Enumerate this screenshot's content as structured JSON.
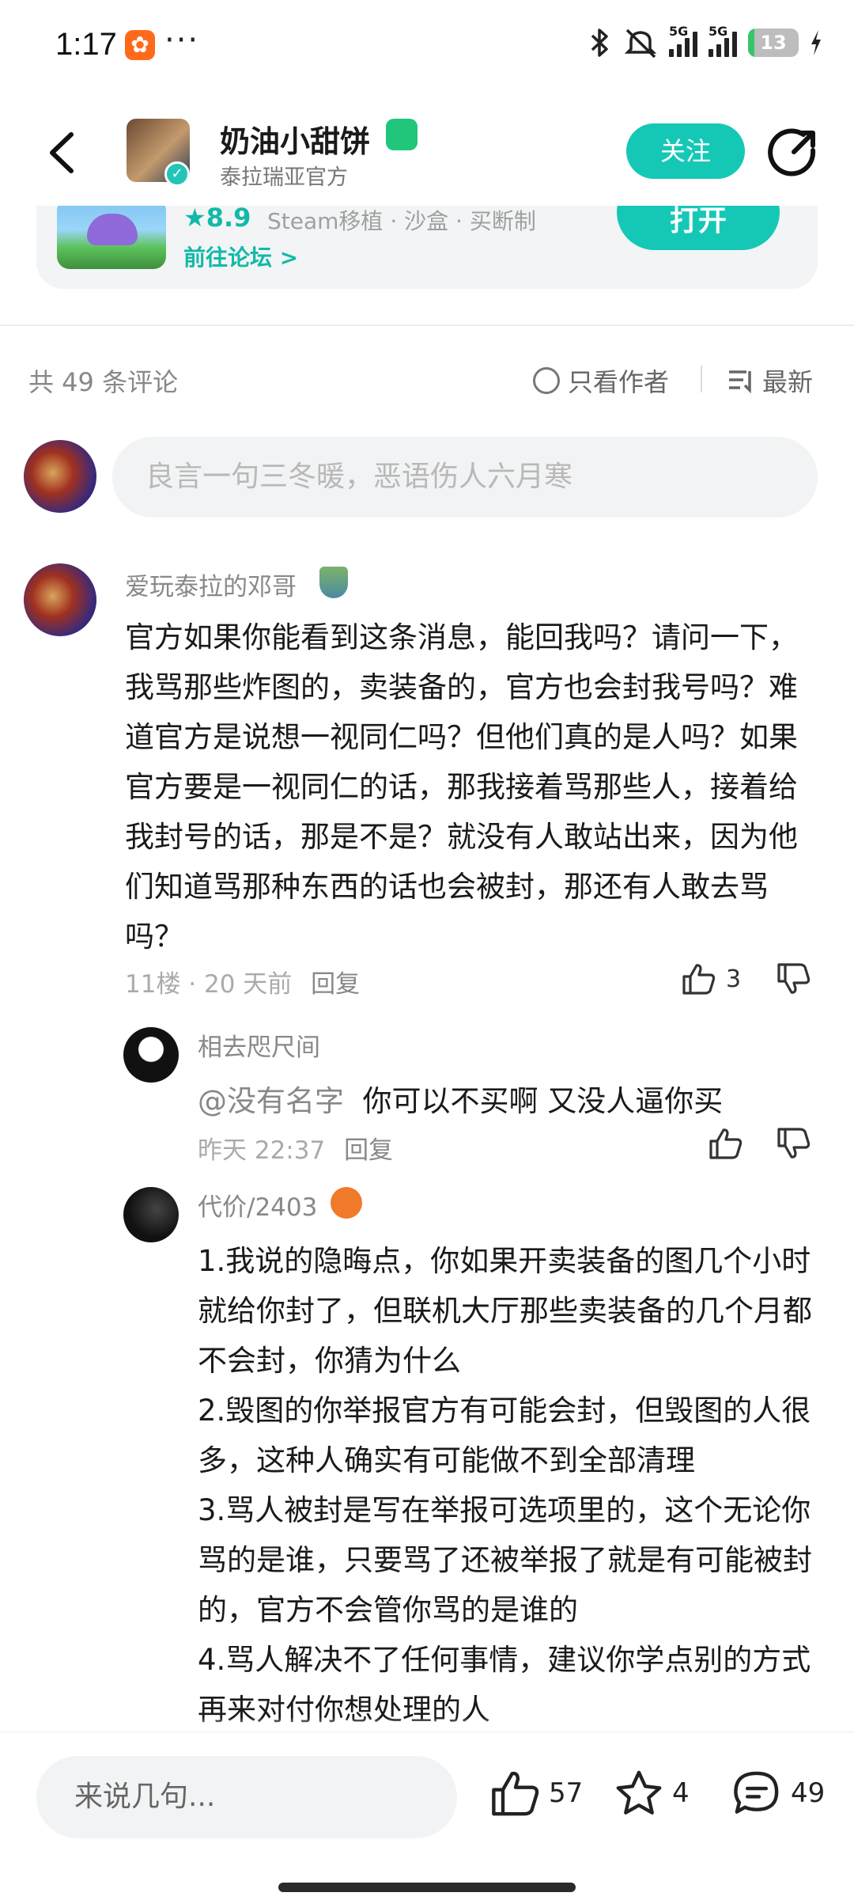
{
  "status_bar": {
    "time": "1:17",
    "app_icon": "taptap-app-icon",
    "more": "···",
    "network1": "5G",
    "network2": "5G",
    "battery": "13",
    "battery_level_percent": 13
  },
  "header": {
    "username": "奶油小甜饼",
    "subtitle": "泰拉瑞亚官方",
    "follow_label": "关注"
  },
  "game_card": {
    "rating": "★8.9",
    "tags": "Steam移植 · 沙盒 · 买断制",
    "forum_link": "前往论坛 >",
    "open_label": "打开"
  },
  "comments_bar": {
    "count": "共 49 条评论",
    "author_only": "只看作者",
    "sort": "最新"
  },
  "comment_input": {
    "placeholder": "良言一句三冬暖，恶语伤人六月寒"
  },
  "comment": {
    "author": "爱玩泰拉的邓哥",
    "text": "官方如果你能看到这条消息，能回我吗？请问一下，我骂那些炸图的，卖装备的，官方也会封我号吗？难道官方是说想一视同仁吗？但他们真的是人吗？如果官方要是一视同仁的话，那我接着骂那些人，接着给我封号的话，那是不是？就没有人敢站出来，因为他们知道骂那种东西的话也会被封，那还有人敢去骂吗？",
    "floor_time": "11楼 · 20 天前",
    "reply_label": "回复",
    "likes": "3"
  },
  "replies": [
    {
      "author": "相去咫尺间",
      "mention": "@没有名字",
      "text": "你可以不买啊  又没人逼你买",
      "time": "昨天 22:37",
      "reply_label": "回复"
    },
    {
      "author": "代价/2403",
      "text": "1.我说的隐晦点，你如果开卖装备的图几个小时就给你封了，但联机大厅那些卖装备的几个月都不会封，你猜为什么\n2.毁图的你举报官方有可能会封，但毁图的人很多，这种人确实有可能做不到全部清理\n3.骂人被封是写在举报可选项里的，这个无论你骂的是谁，只要骂了还被举报了就是有可能被封的，官方不会管你骂的是谁的\n4.骂人解决不了任何事情，建议你学点别的方式再来对付你想处理的人"
    }
  ],
  "bottom_bar": {
    "input_placeholder": "来说几句...",
    "likes": "57",
    "favorites": "4",
    "comments": "49"
  }
}
